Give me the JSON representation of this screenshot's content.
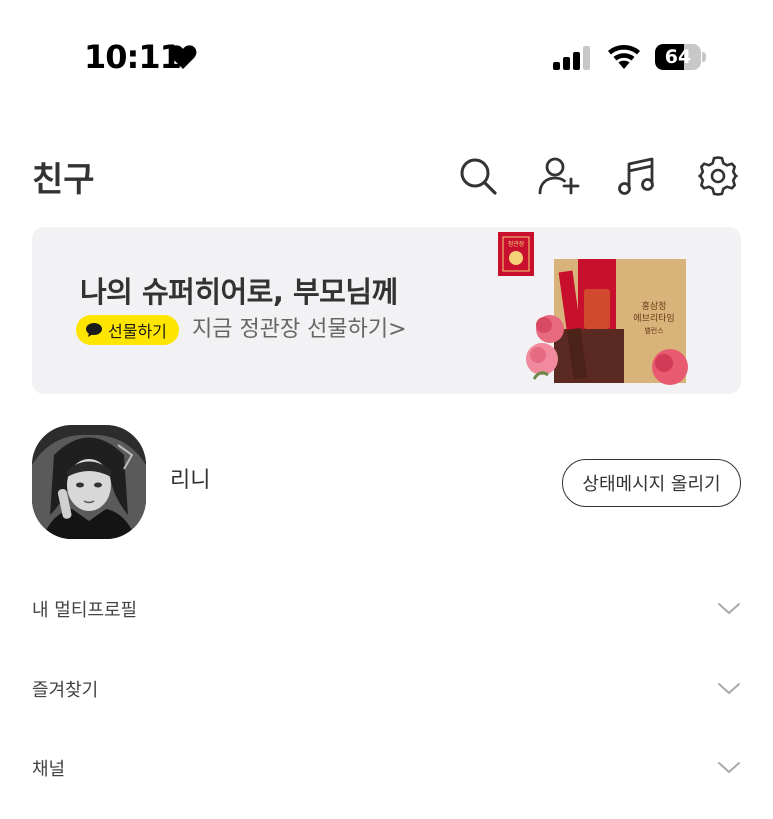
{
  "status_bar": {
    "time": "10:11",
    "battery_level": "64",
    "battery_percent": 64
  },
  "header": {
    "title": "친구",
    "icons": [
      "search-icon",
      "add-friend-icon",
      "music-icon",
      "settings-icon"
    ]
  },
  "banner": {
    "title": "나의 슈퍼히어로, 부모님께",
    "chip_label": "선물하기",
    "subtitle": "지금 정관장 선물하기>",
    "chip_color": "#fee500",
    "product_logo_text": "정관장",
    "product_box_text_1": "홍삼정",
    "product_box_text_2": "에브리타임",
    "product_box_text_3": "밸런스"
  },
  "profile": {
    "name": "리니",
    "status_button_label": "상태메시지 올리기"
  },
  "sections": [
    {
      "label": "내 멀티프로필"
    },
    {
      "label": "즐겨찾기"
    },
    {
      "label": "채널"
    }
  ],
  "colors": {
    "accent_yellow": "#fee500",
    "banner_bg": "#f2f2f4",
    "text_dark": "#333333"
  }
}
